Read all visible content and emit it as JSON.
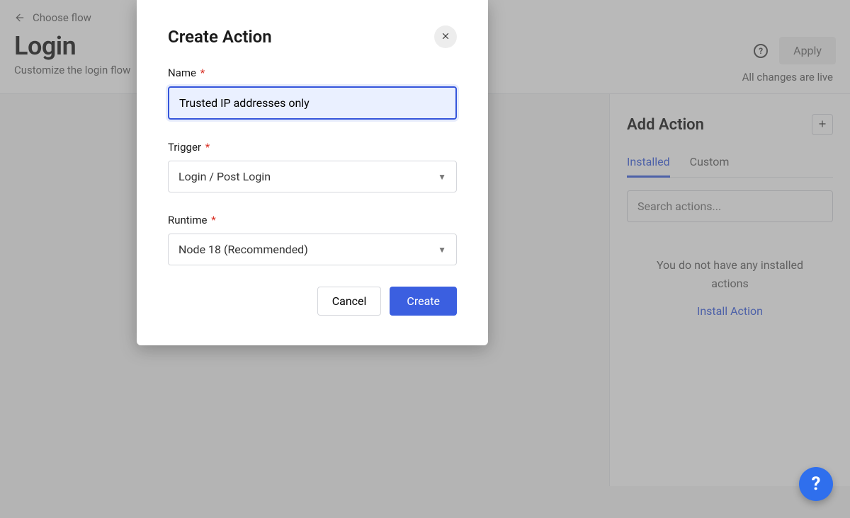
{
  "header": {
    "back_label": "Choose flow",
    "title": "Login",
    "subtitle": "Customize the login flow",
    "apply_label": "Apply",
    "changes_live": "All changes are live"
  },
  "sidebar": {
    "title": "Add Action",
    "tabs": [
      "Installed",
      "Custom"
    ],
    "active_tab": 0,
    "search_placeholder": "Search actions...",
    "empty_state_line1": "You do not have any installed",
    "empty_state_line2": "actions",
    "install_link": "Install Action"
  },
  "modal": {
    "title": "Create Action",
    "name_label": "Name",
    "name_value": "Trusted IP addresses only",
    "trigger_label": "Trigger",
    "trigger_value": "Login / Post Login",
    "runtime_label": "Runtime",
    "runtime_value": "Node 18 (Recommended)",
    "cancel_label": "Cancel",
    "create_label": "Create"
  }
}
